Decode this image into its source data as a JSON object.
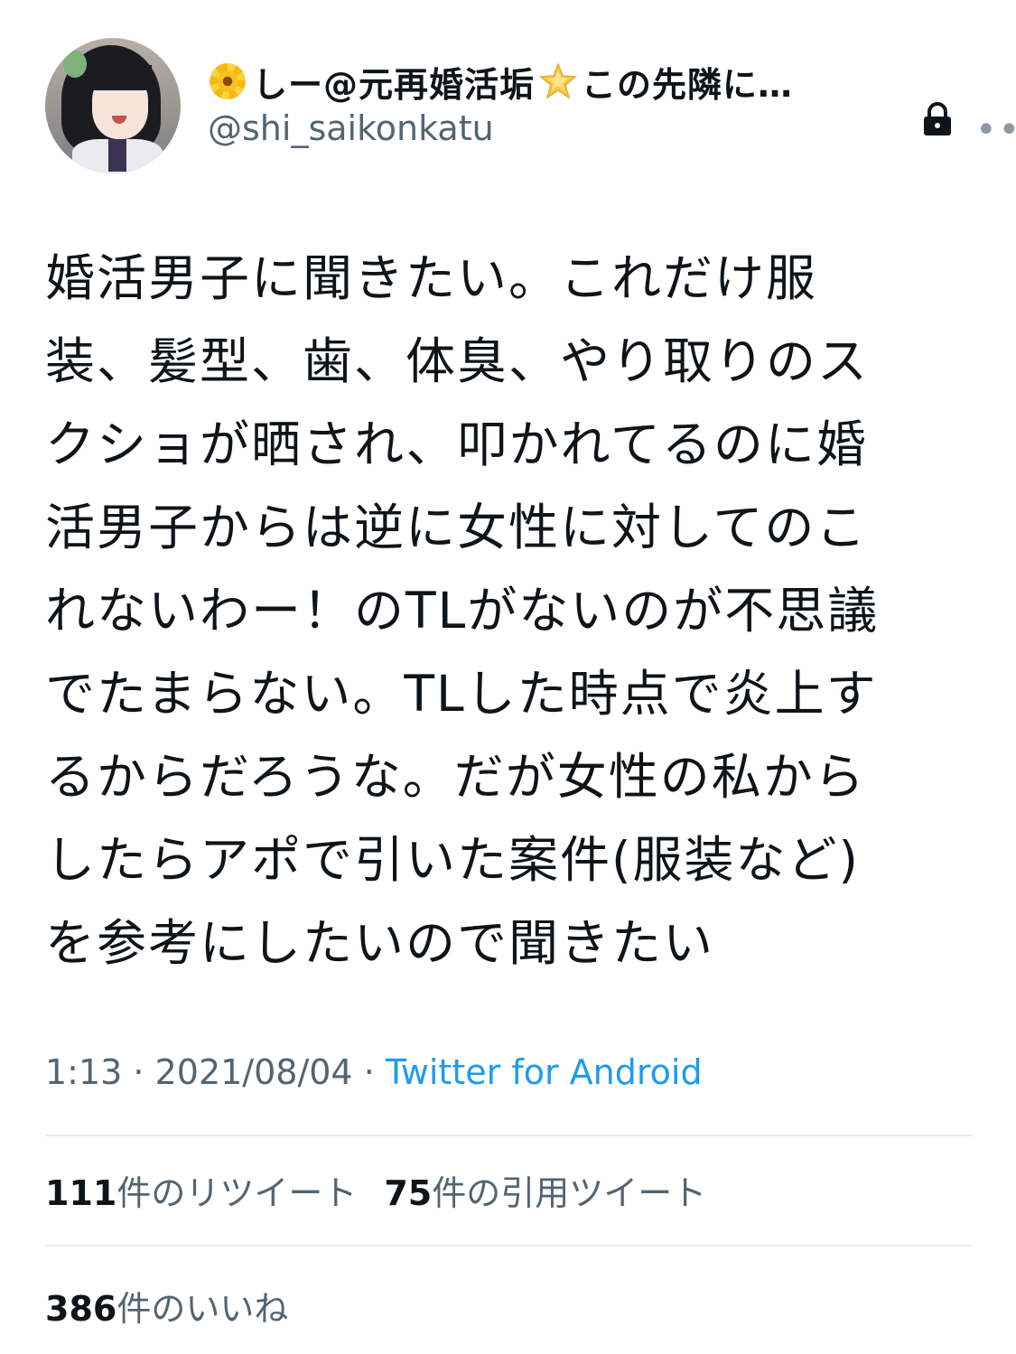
{
  "tweet": {
    "author": {
      "display_name": "しー@元再婚活垢",
      "display_name_suffix": "この先隣に…",
      "handle": "@shi_saikonkatu",
      "name_icons": [
        "flower-icon",
        "star-icon"
      ],
      "protected_icon": "lock-icon"
    },
    "more_label": "•••",
    "text": "婚活男子に聞きたい。これだけ服\n装、髪型、歯、体臭、やり取りのス\nクショが晒され、叩かれてるのに婚\n活男子からは逆に女性に対してのこ\nれないわー！のTLがないのが不思議\nでたまらない。TLした時点で炎上す\nるからだろうな。だが女性の私から\nしたらアポで引いた案件(服装など)\nを参考にしたいので聞きたい",
    "meta": {
      "time": "1:13",
      "separator1": " · ",
      "date": "2021/08/04",
      "separator2": " · ",
      "source": "Twitter for Android"
    },
    "stats": {
      "retweets_count": "111",
      "retweets_label": "件のリツイート",
      "quotes_count": "75",
      "quotes_label": "件の引用ツイート",
      "likes_count": "386",
      "likes_label": "件のいいね"
    }
  },
  "colors": {
    "text_primary": "#0f1419",
    "text_secondary": "#536471",
    "link": "#1d9bf0",
    "divider": "#e6e9ec"
  }
}
